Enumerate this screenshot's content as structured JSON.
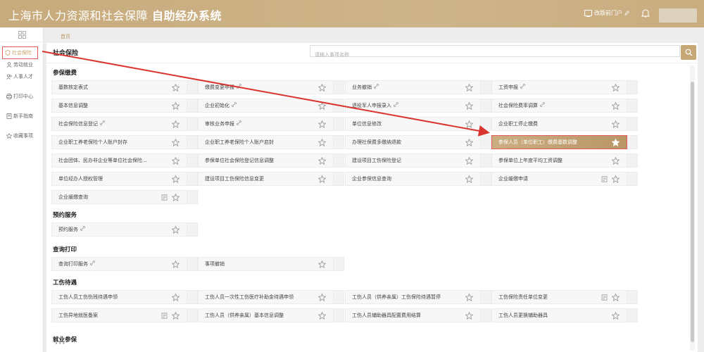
{
  "header": {
    "title_prefix": "上海市人力资源和社会保障",
    "title_bold": "自助经办系统",
    "portal_link": "改版前门户"
  },
  "sidebar": {
    "items": [
      {
        "label": "社会保险",
        "icon": "shield-icon",
        "active": true
      },
      {
        "label": "劳动就业",
        "icon": "person-icon"
      },
      {
        "label": "人事人才",
        "icon": "people-icon"
      },
      {
        "label": "打印中心",
        "icon": "printer-icon"
      },
      {
        "label": "新手指南",
        "icon": "book-icon"
      },
      {
        "label": "收藏事项",
        "icon": "star-icon"
      }
    ]
  },
  "breadcrumb": "首页",
  "page": {
    "heading": "社会保险",
    "search_placeholder": "请输入事项名称"
  },
  "sections": [
    {
      "title": "参保缴费",
      "items": [
        {
          "label": "基数核定表式"
        },
        {
          "label": "缴费变更申报",
          "link": true
        },
        {
          "label": "业务撤销",
          "link": true
        },
        {
          "label": "工资申报",
          "link": true
        },
        {
          "label": "基本信息调整"
        },
        {
          "label": "企业初始化",
          "link": true
        },
        {
          "label": "退役军人申报录入",
          "link": true
        },
        {
          "label": "社会保险费率调算",
          "link": true
        },
        {
          "label": "社会保险信息登记",
          "link": true
        },
        {
          "label": "审核业务申报",
          "link": true
        },
        {
          "label": "单位信息修改"
        },
        {
          "label": "企业职工停止缴费"
        },
        {
          "label": "企业职工养老保险个人账户封存"
        },
        {
          "label": "企业职工养老保险个人账户启封"
        },
        {
          "label": "办理社保费多缴纳退款"
        },
        {
          "label": "参保人员（单位职工）缴费基数调整",
          "highlight": true
        },
        {
          "label": "社会团体、民办非企业等单位社会保险..."
        },
        {
          "label": "参保单位社会保险登记信息调整"
        },
        {
          "label": "建设项目工伤保险登记"
        },
        {
          "label": "参保单位上年度平均工资调整"
        },
        {
          "label": "单位经办人授权管理"
        },
        {
          "label": "建设项目工伤保险信息变更"
        },
        {
          "label": "企业参保信息查询"
        },
        {
          "label": "企业缓缴申请",
          "doc": true
        },
        {
          "label": "企业缓缴查询",
          "doc": true
        }
      ]
    },
    {
      "title": "预约服务",
      "items": [
        {
          "label": "预约服务",
          "link": true
        }
      ]
    },
    {
      "title": "查询打印",
      "items": [
        {
          "label": "查询打印服务",
          "link": true
        },
        {
          "label": "事项撤销"
        }
      ]
    },
    {
      "title": "工伤待遇",
      "items": [
        {
          "label": "工伤人员工伤伤残待遇申领"
        },
        {
          "label": "工伤人员一次性工伤医疗补助金待遇申领"
        },
        {
          "label": "工伤人员（供养亲属）工伤保险待遇暂停"
        },
        {
          "label": "工伤保险责任单位变更",
          "doc": true
        },
        {
          "label": "工伤异地就医备案",
          "doc": true
        },
        {
          "label": "工伤人员（供养亲属）基本信息调整"
        },
        {
          "label": "工伤人员辅助器具配置费用结算"
        },
        {
          "label": "工伤人员更换辅助器具"
        }
      ]
    },
    {
      "title": "就业参保",
      "items": []
    }
  ],
  "more_text": "•••",
  "colors": {
    "brand": "#c7ab7c",
    "accent_text": "#b9955f",
    "annotation_red": "#d9352f"
  }
}
